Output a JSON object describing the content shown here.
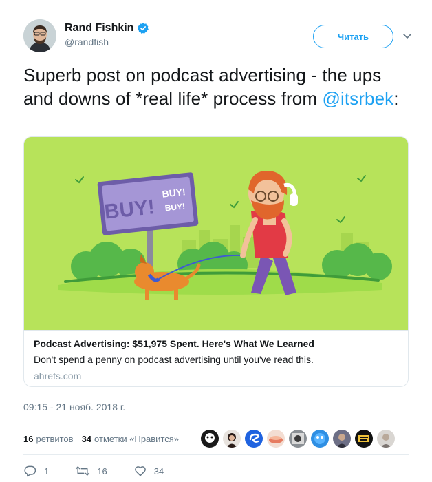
{
  "author": {
    "display_name": "Rand Fishkin",
    "handle": "@randfish",
    "verified_icon": "verified-badge-icon",
    "verified_color": "#1da1f2"
  },
  "follow_button": {
    "label": "Читать"
  },
  "tweet": {
    "text_before": "Superb post on podcast advertising - the ups and downs of *real life* process from ",
    "mention": "@itsrbek",
    "text_after": ":"
  },
  "card": {
    "image_text_main": "BUY!",
    "image_text_side_1": "BUY!",
    "image_text_side_2": "BUY!",
    "title": "Podcast Advertising: $51,975 Spent. Here's What We Learned",
    "description": "Don't spend a penny on podcast advertising until you've read this.",
    "domain": "ahrefs.com"
  },
  "timestamp": "09:15 - 21 нояб. 2018 г.",
  "stats": {
    "retweets_count": "16",
    "retweets_label": "ретвитов",
    "likes_count": "34",
    "likes_label": "отметки «Нравится»"
  },
  "likers_count": 9,
  "actions": {
    "reply_count": "1",
    "retweet_count": "16",
    "like_count": "34"
  },
  "colors": {
    "accent": "#1da1f2",
    "text": "#14171a",
    "secondary": "#657786"
  }
}
